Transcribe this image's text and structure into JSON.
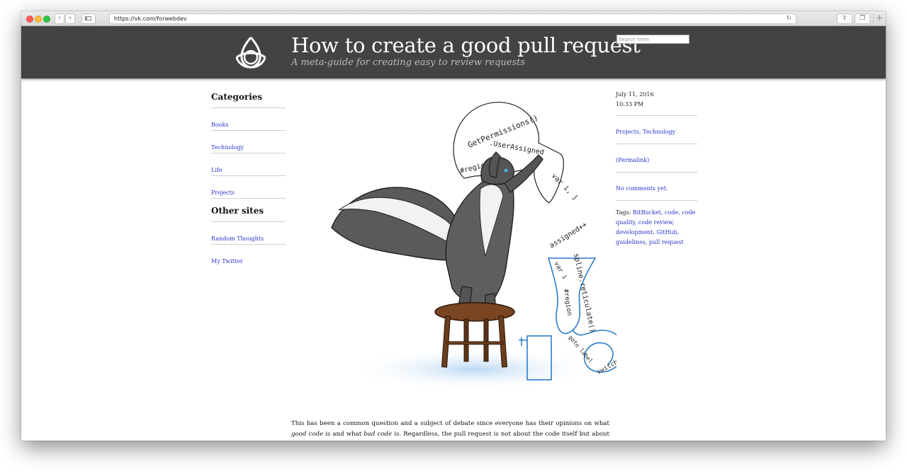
{
  "browser": {
    "url": "https://vk.com/forwebdev",
    "back_label": "‹",
    "forward_label": "›",
    "reload_label": "↻",
    "share_label": "⇪",
    "tabs_label": "❐",
    "newtab_label": "+"
  },
  "site": {
    "title": "How to create a good pull request",
    "tagline": "A meta-guide for creating easy to review requests",
    "search_placeholder": "Search term"
  },
  "sidebar": {
    "categories_heading": "Categories",
    "categories": [
      {
        "label": "Books"
      },
      {
        "label": "Technology"
      },
      {
        "label": "Life"
      },
      {
        "label": "Projects"
      }
    ],
    "other_heading": "Other sites",
    "other_sites": [
      {
        "label": "Random Thoughts"
      },
      {
        "label": "My Twitter"
      }
    ]
  },
  "illustration": {
    "bubble_line1": "GetPermissions()",
    "bubble_line2": ".UserAssigned",
    "bubble_line3": "#region",
    "flask_text": "var i, j",
    "assigned_text": "assigned++",
    "tube_text1": "spline.reticulate()",
    "tube_text2": "var i",
    "tube_text3": "#region",
    "coil_text1": "goto label",
    "coil_text2": "switch"
  },
  "post": {
    "date": "July 11, 2016",
    "time": "10:33 PM",
    "categories_link": "Projects, Technology",
    "permalink": "(Permalink)",
    "comments": "No comments yet.",
    "tags_label": "Tags:",
    "tags_text": "BitBucket, code, code quality, code review, development, GitHub, guidelines, pull request",
    "body_p1": "This has been a common question and a subject of debate since everyone has their opinions on what ",
    "body_em1": "good code",
    "body_p2": " is and what ",
    "body_em2": "bad code",
    "body_p3": " is. Regardless, the pull request is not about the code itself but about the"
  },
  "colors": {
    "header_bg": "#434343",
    "link": "#2a35c9",
    "apparatus_blue": "#2a7cc7",
    "stool_brown": "#6b3d1c"
  }
}
